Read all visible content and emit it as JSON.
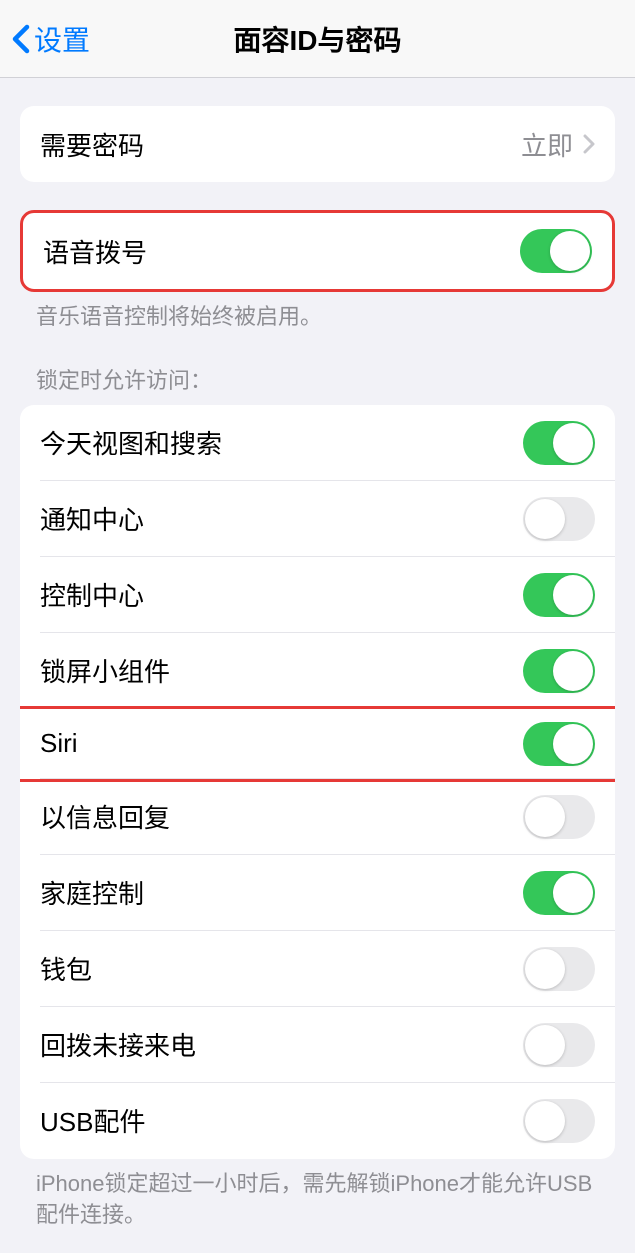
{
  "header": {
    "back_label": "设置",
    "title": "面容ID与密码"
  },
  "require_passcode": {
    "label": "需要密码",
    "value": "立即"
  },
  "voice_dial": {
    "label": "语音拨号",
    "on": true,
    "footer": "音乐语音控制将始终被启用。"
  },
  "lock_access": {
    "header": "锁定时允许访问：",
    "items": [
      {
        "label": "今天视图和搜索",
        "on": true
      },
      {
        "label": "通知中心",
        "on": false
      },
      {
        "label": "控制中心",
        "on": true
      },
      {
        "label": "锁屏小组件",
        "on": true
      },
      {
        "label": "Siri",
        "on": true
      },
      {
        "label": "以信息回复",
        "on": false
      },
      {
        "label": "家庭控制",
        "on": true
      },
      {
        "label": "钱包",
        "on": false
      },
      {
        "label": "回拨未接来电",
        "on": false
      },
      {
        "label": "USB配件",
        "on": false
      }
    ],
    "footer": "iPhone锁定超过一小时后，需先解锁iPhone才能允许USB配件连接。"
  }
}
